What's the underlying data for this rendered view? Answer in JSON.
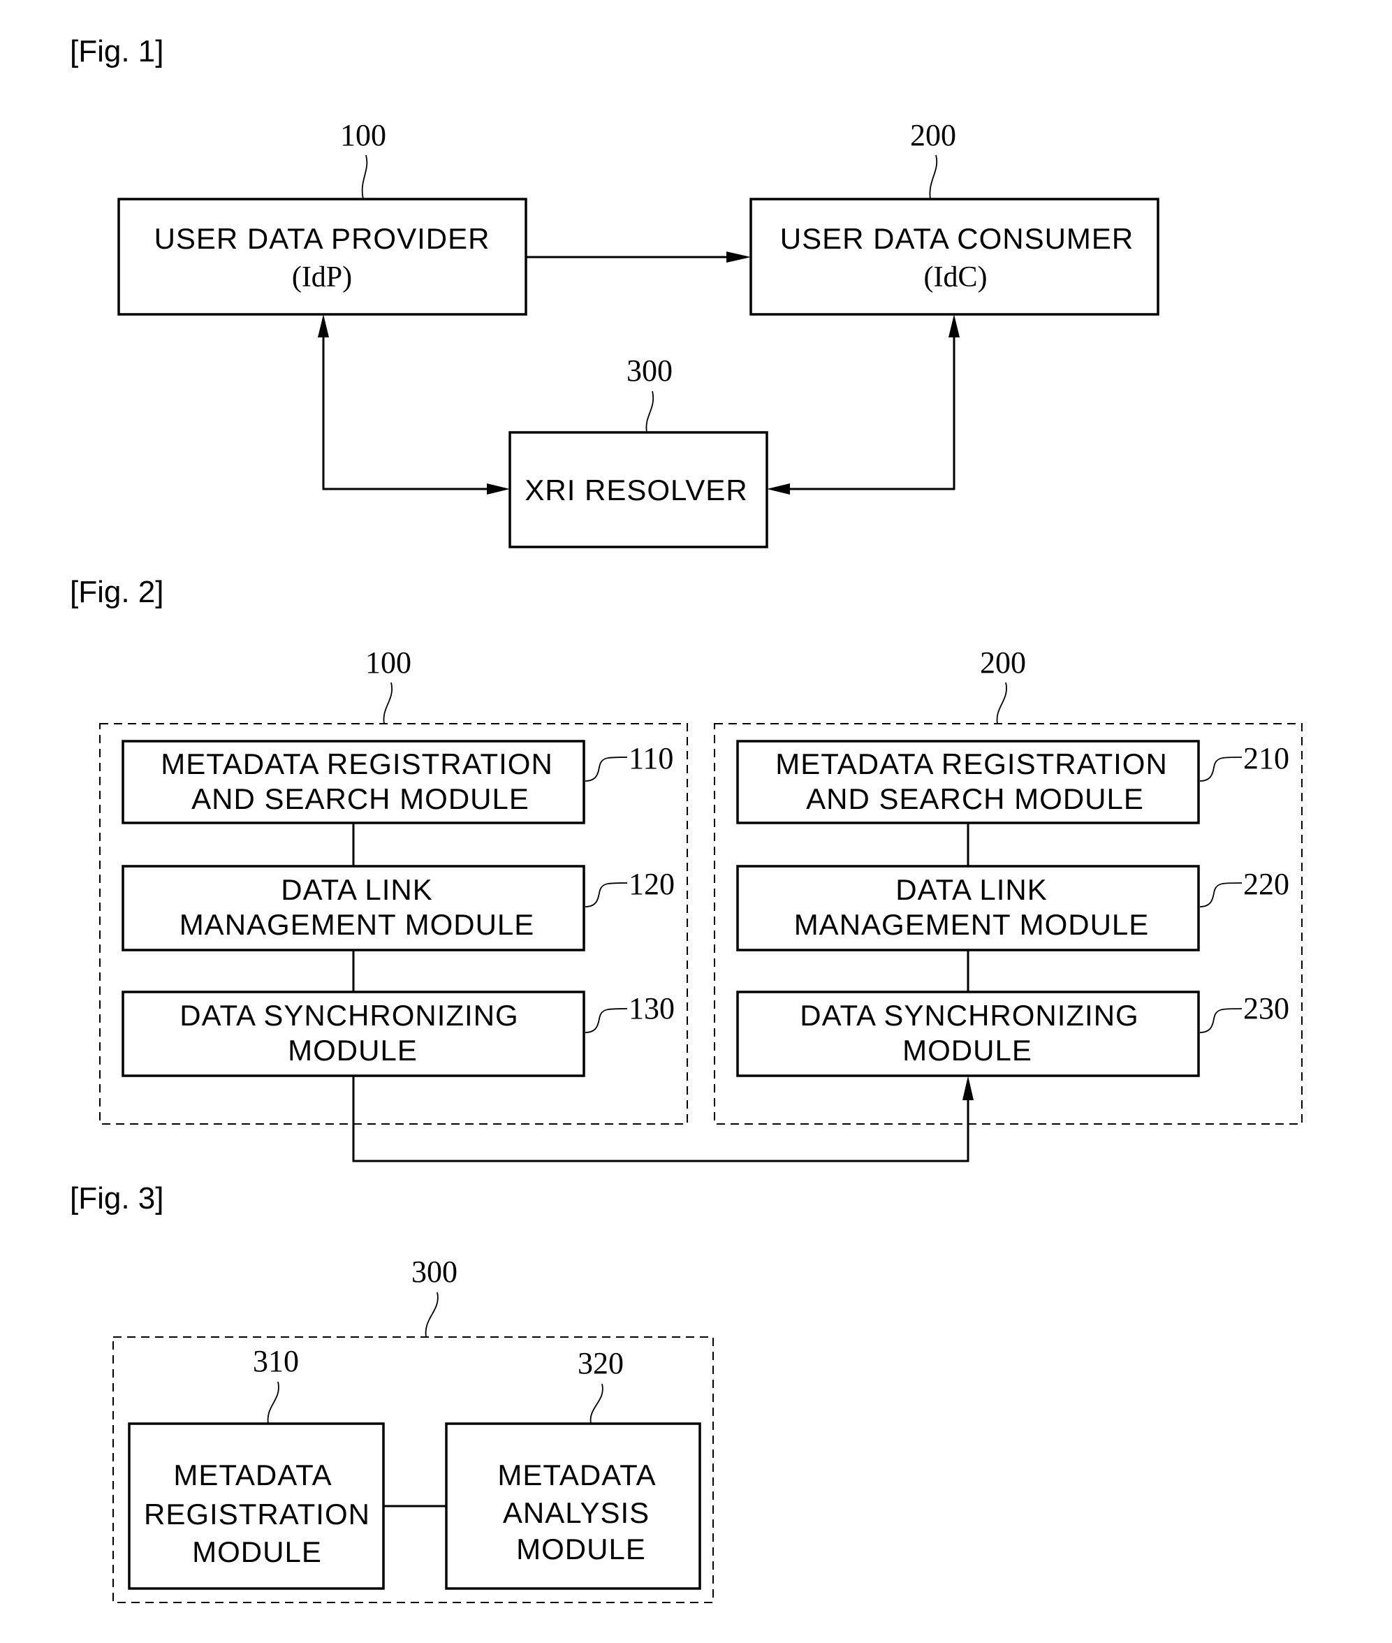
{
  "fig1": {
    "label": "[Fig. 1]",
    "provider": {
      "ref": "100",
      "line1": "USER DATA PROVIDER",
      "line2": "(IdP)"
    },
    "consumer": {
      "ref": "200",
      "line1": "USER DATA CONSUMER",
      "line2": "(IdC)"
    },
    "resolver": {
      "ref": "300",
      "line1": "XRI RESOLVER"
    }
  },
  "fig2": {
    "label": "[Fig. 2]",
    "groups": [
      {
        "ref": "100",
        "modules": [
          {
            "ref": "110",
            "line1": "METADATA REGISTRATION",
            "line2": "AND SEARCH MODULE"
          },
          {
            "ref": "120",
            "line1": "DATA LINK",
            "line2": "MANAGEMENT MODULE"
          },
          {
            "ref": "130",
            "line1": "DATA SYNCHRONIZING",
            "line2": "MODULE"
          }
        ]
      },
      {
        "ref": "200",
        "modules": [
          {
            "ref": "210",
            "line1": "METADATA REGISTRATION",
            "line2": "AND SEARCH MODULE"
          },
          {
            "ref": "220",
            "line1": "DATA LINK",
            "line2": "MANAGEMENT MODULE"
          },
          {
            "ref": "230",
            "line1": "DATA SYNCHRONIZING",
            "line2": "MODULE"
          }
        ]
      }
    ]
  },
  "fig3": {
    "label": "[Fig. 3]",
    "ref": "300",
    "modules": [
      {
        "ref": "310",
        "line1": "METADATA",
        "line2": "REGISTRATION",
        "line3": "MODULE"
      },
      {
        "ref": "320",
        "line1": "METADATA",
        "line2": "ANALYSIS",
        "line3": "MODULE"
      }
    ]
  }
}
